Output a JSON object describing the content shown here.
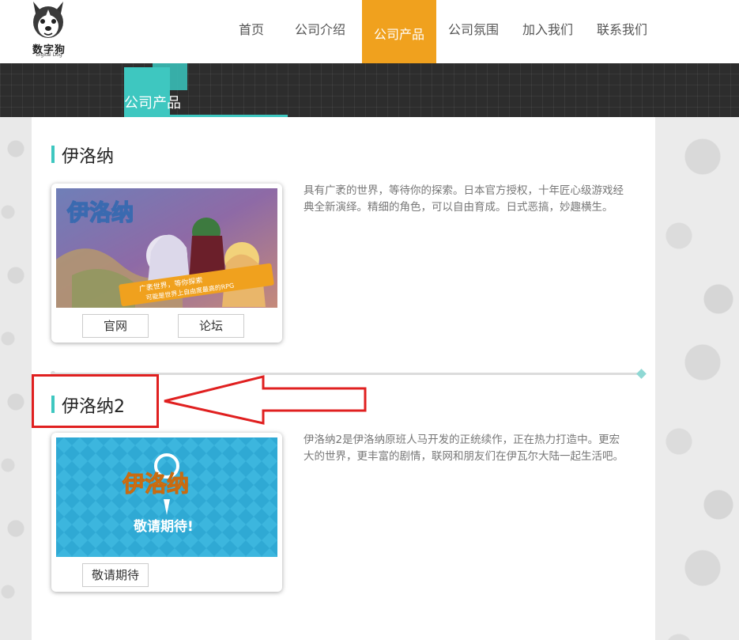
{
  "header": {
    "logo": {
      "text": "数字狗",
      "sub": "Digital Dog"
    },
    "nav": [
      {
        "label": "首页",
        "active": false
      },
      {
        "label": "公司介绍",
        "active": false
      },
      {
        "label": "公司产品",
        "active": true
      },
      {
        "label": "公司氛围",
        "active": false
      },
      {
        "label": "加入我们",
        "active": false
      },
      {
        "label": "联系我们",
        "active": false
      }
    ]
  },
  "banner": {
    "title": "公司产品"
  },
  "products": [
    {
      "title": "伊洛纳",
      "description": "具有广袤的世界，等待你的探索。日本官方授权，十年匠心级游戏经典全新演绎。精细的角色，可以自由育成。日式恶搞，妙趣横生。",
      "image": {
        "logo_text": "伊洛纳",
        "ribbon1": "广袤世界，等你探索",
        "ribbon2": "可能是世界上自由度最高的RPG"
      },
      "buttons": [
        "官网",
        "论坛"
      ]
    },
    {
      "title": "伊洛纳2",
      "description": "伊洛纳2是伊洛纳原班人马开发的正统续作，正在热力打造中。更宏大的世界，更丰富的剧情，联网和朋友们在伊瓦尔大陆一起生活吧。",
      "image": {
        "logo_text": "伊洛纳",
        "coming": "敬请期待!"
      },
      "buttons": [
        "敬请期待"
      ]
    }
  ],
  "colors": {
    "accent": "#3ec7c0",
    "nav_active": "#f0a11e",
    "annotation": "#e02020"
  }
}
